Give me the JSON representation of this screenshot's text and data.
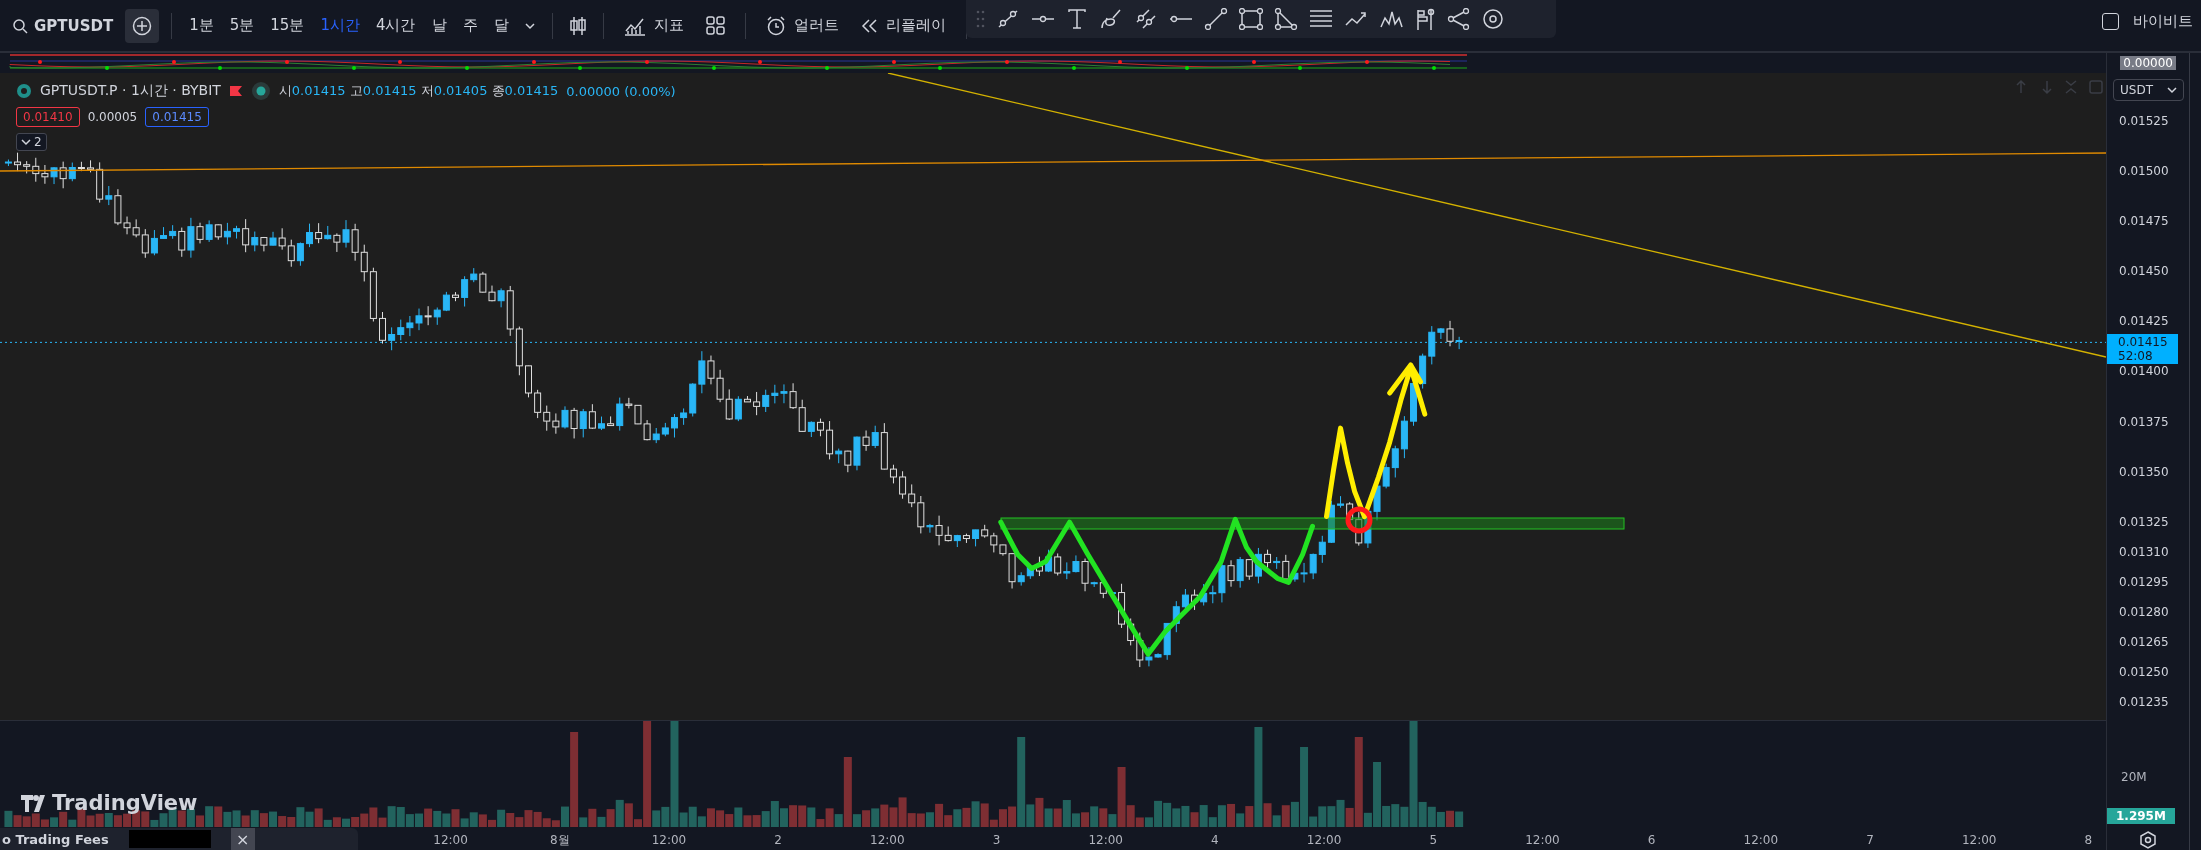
{
  "toolbar": {
    "symbol": "GPTUSDT",
    "intervals": [
      {
        "label": "1분",
        "selected": false
      },
      {
        "label": "5분",
        "selected": false
      },
      {
        "label": "15분",
        "selected": false
      },
      {
        "label": "1시간",
        "selected": true
      },
      {
        "label": "4시간",
        "selected": false
      },
      {
        "label": "날",
        "selected": false
      },
      {
        "label": "주",
        "selected": false
      },
      {
        "label": "달",
        "selected": false
      }
    ],
    "buttons": [
      {
        "kind": "indicators",
        "label": "지표"
      },
      {
        "kind": "templates"
      },
      {
        "kind": "alert",
        "label": "얼러트"
      },
      {
        "kind": "replay",
        "label": "리플레이"
      }
    ]
  },
  "top_right": {
    "checked": false,
    "label": "바이비트"
  },
  "indicator_pane": {
    "axis_label": "0.00000"
  },
  "legend": {
    "title": "GPTUSDT.P · 1시간 · BYBIT",
    "ohlc": [
      {
        "label": "시",
        "value": "0.01415"
      },
      {
        "label": "고",
        "value": "0.01415"
      },
      {
        "label": "저",
        "value": "0.01405"
      },
      {
        "label": "종",
        "value": "0.01415"
      }
    ],
    "change": "0.00000 (0.00%)",
    "bid": "0.01410",
    "spread": "0.00005",
    "ask": "0.01415",
    "layers": "2"
  },
  "price_axis": {
    "currency": "USDT",
    "ticks": [
      "0.01525",
      "0.01500",
      "0.01475",
      "0.01450",
      "0.01425",
      "0.01400",
      "0.01375",
      "0.01350",
      "0.01325",
      "0.01310",
      "0.01295",
      "0.01280",
      "0.01265",
      "0.01250",
      "0.01235"
    ],
    "last_price": "0.01415",
    "countdown": "52:08"
  },
  "volume_axis": {
    "tick": "20M",
    "last_volume": "1.295M"
  },
  "logo": "TradingView",
  "time_axis": {
    "labels": [
      "12:00",
      "8월",
      "12:00",
      "2",
      "12:00",
      "3",
      "12:00",
      "4",
      "12:00",
      "5",
      "12:00",
      "6",
      "12:00",
      "7",
      "12:00",
      "8"
    ]
  },
  "popup": {
    "title": "o Trading Fees",
    "close": "×"
  }
}
